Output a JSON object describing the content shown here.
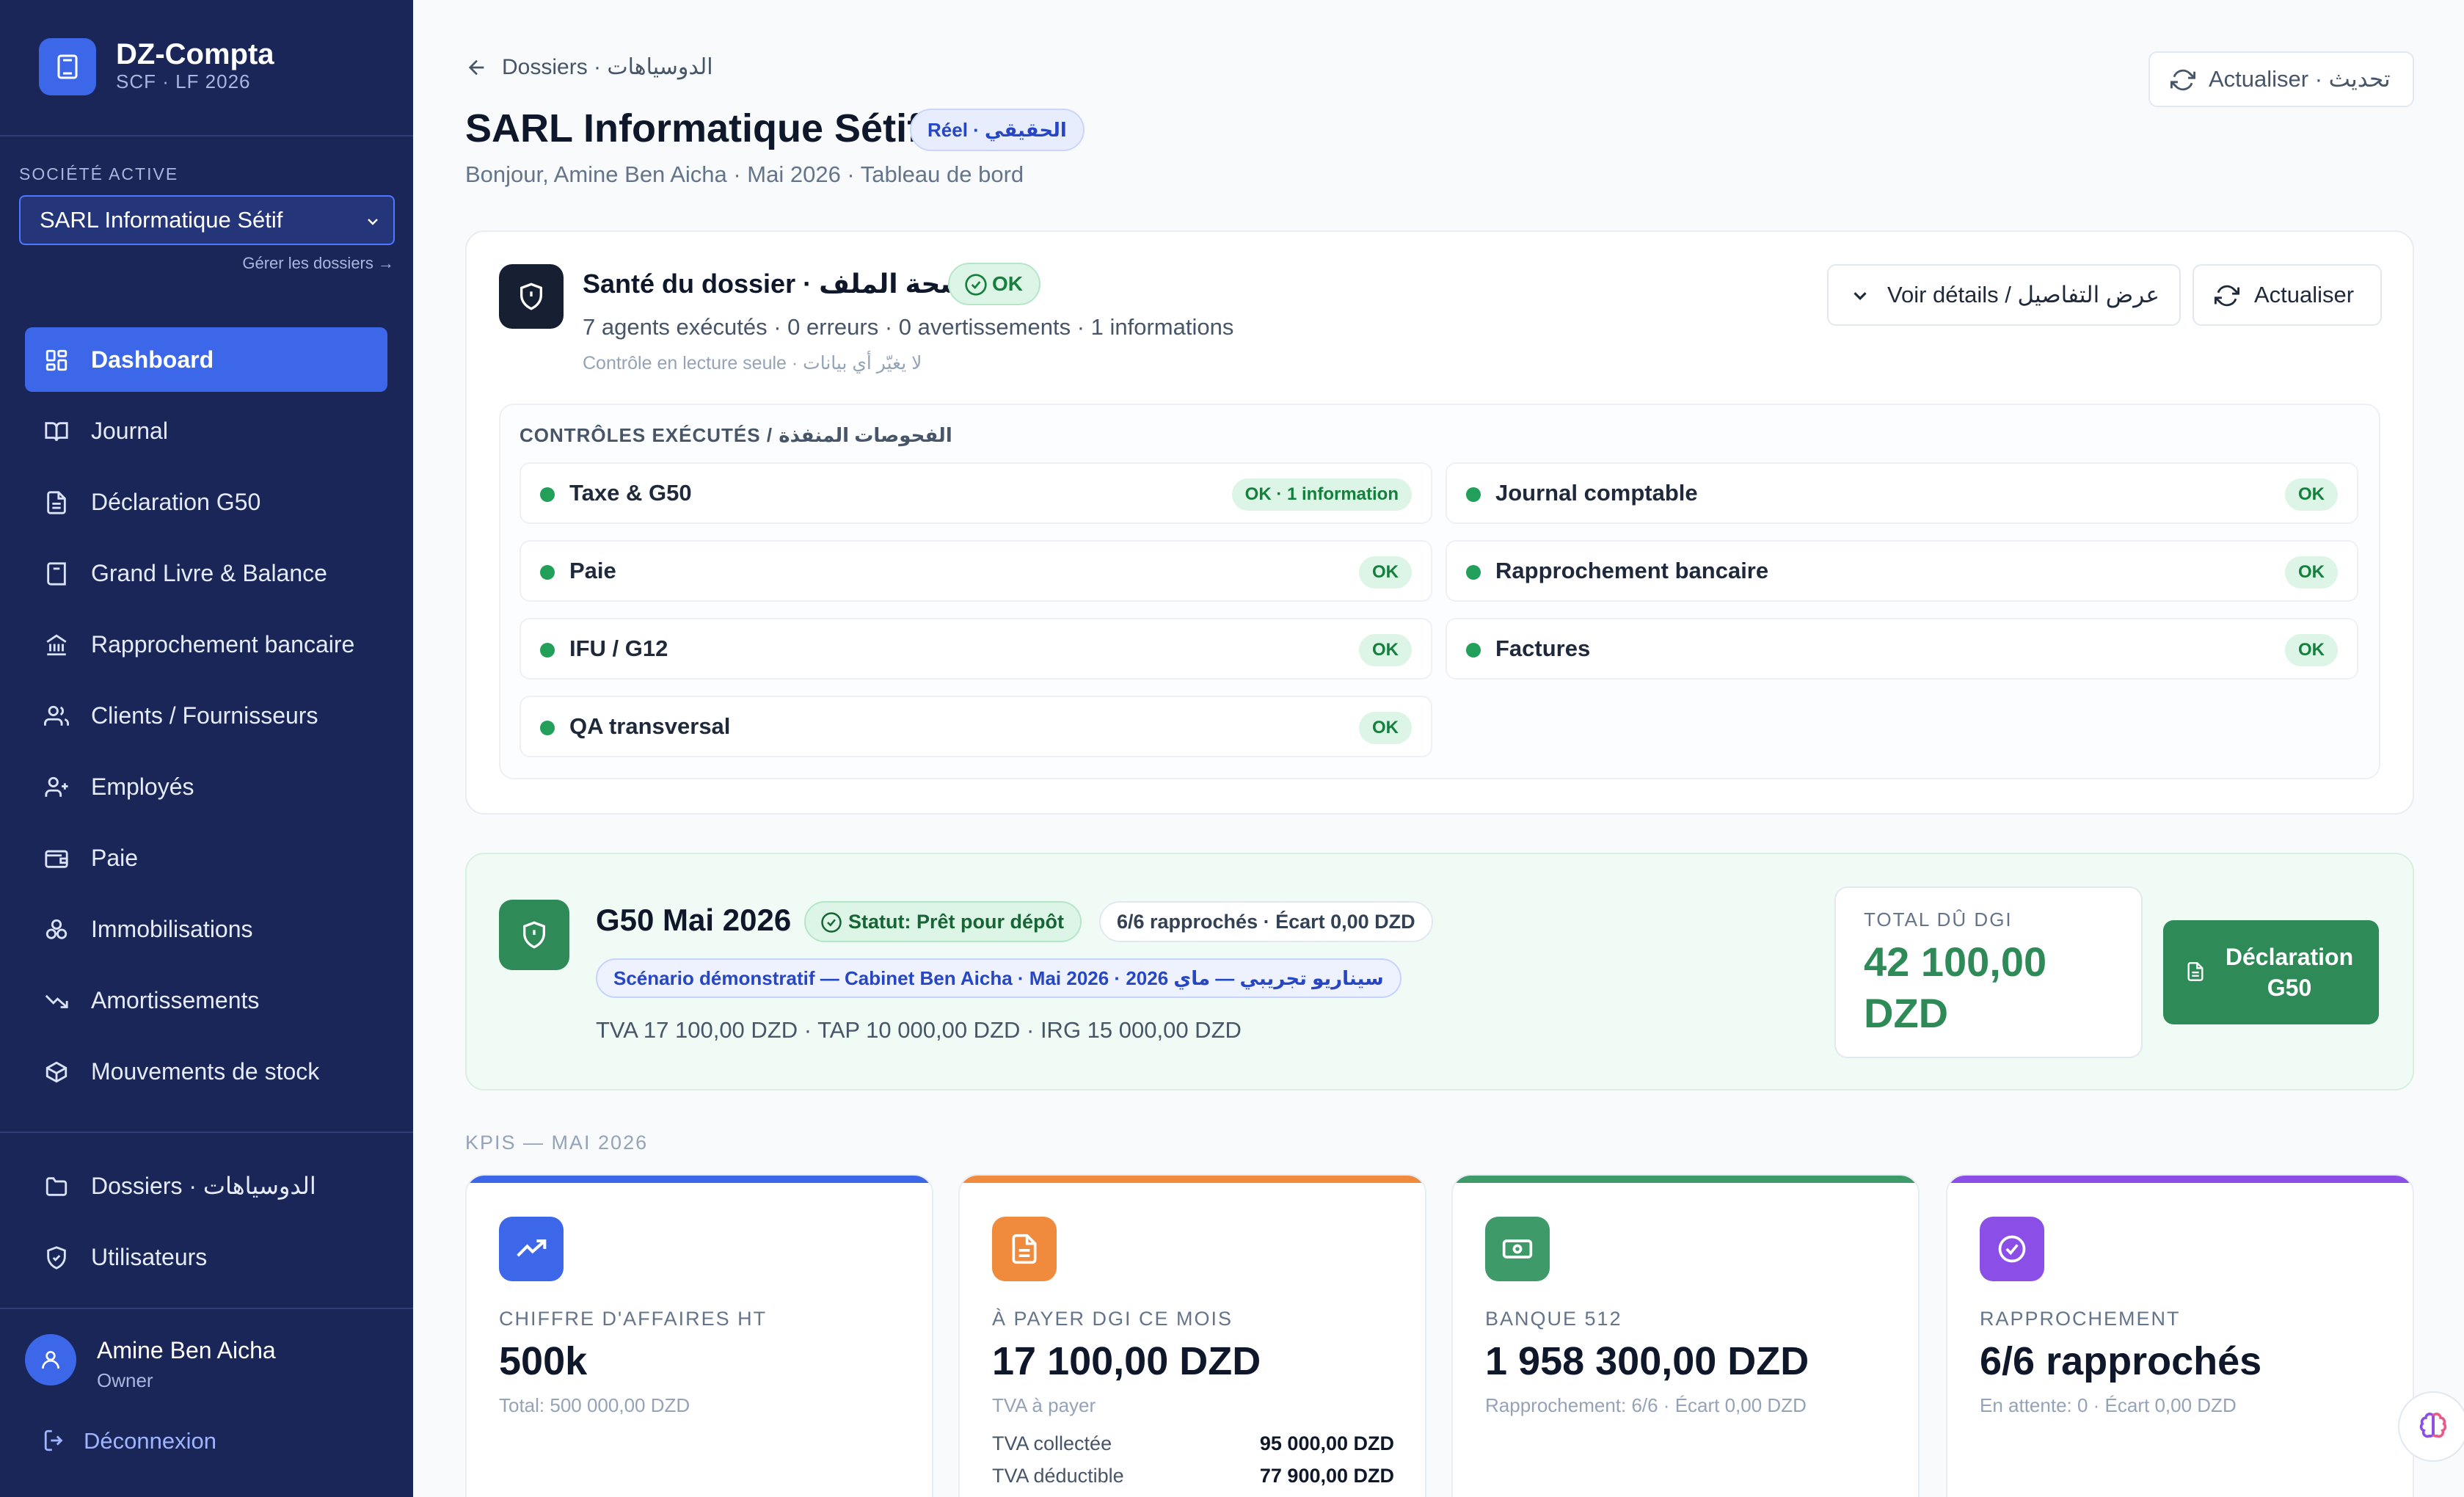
{
  "app": {
    "name": "DZ-Compta",
    "subtitle": "SCF · LF 2026"
  },
  "sidebar": {
    "company_label": "SOCIÉTÉ ACTIVE",
    "company_value": "SARL Informatique Sétif",
    "manage_link": "Gérer les dossiers →",
    "nav": [
      {
        "label": "Dashboard",
        "icon": "grid-icon",
        "active": true
      },
      {
        "label": "Journal",
        "icon": "book-open-icon"
      },
      {
        "label": "Déclaration G50",
        "icon": "document-icon"
      },
      {
        "label": "Grand Livre & Balance",
        "icon": "ledger-icon"
      },
      {
        "label": "Rapprochement bancaire",
        "icon": "bank-icon"
      },
      {
        "label": "Clients / Fournisseurs",
        "icon": "users-icon"
      },
      {
        "label": "Employés",
        "icon": "user-plus-icon"
      },
      {
        "label": "Paie",
        "icon": "wallet-icon"
      },
      {
        "label": "Immobilisations",
        "icon": "boxes-icon"
      },
      {
        "label": "Amortissements",
        "icon": "trending-down-icon"
      },
      {
        "label": "Mouvements de stock",
        "icon": "package-icon"
      }
    ],
    "bottom_nav": [
      {
        "label": "Dossiers · الدوسياهات",
        "icon": "folder-icon"
      },
      {
        "label": "Utilisateurs",
        "icon": "shield-icon"
      }
    ],
    "user": {
      "name": "Amine Ben Aicha",
      "role": "Owner"
    },
    "logout": "Déconnexion"
  },
  "header": {
    "back_label": "Dossiers · الدوسياهات",
    "refresh_label": "Actualiser · تحديث",
    "title": "SARL Informatique Sétif",
    "regime_badge": "Réel · الحقيقي",
    "subtitle": "Bonjour, Amine Ben Aicha · Mai 2026 · Tableau de bord"
  },
  "health": {
    "title": "Santé du dossier · صحة الملف",
    "status": "OK",
    "stats": "7 agents exécutés · 0 erreurs · 0 avertissements · 1 informations",
    "note": "Contrôle en lecture seule · لا يغيّر أي بيانات",
    "details_button": "Voir détails / عرض التفاصيل",
    "refresh_button": "Actualiser",
    "checks_label": "CONTRÔLES EXÉCUTÉS / الفحوصات المنفذة",
    "checks": [
      {
        "name": "Taxe & G50",
        "status": "OK · 1 information"
      },
      {
        "name": "Journal comptable",
        "status": "OK"
      },
      {
        "name": "Paie",
        "status": "OK"
      },
      {
        "name": "Rapprochement bancaire",
        "status": "OK"
      },
      {
        "name": "IFU / G12",
        "status": "OK"
      },
      {
        "name": "Factures",
        "status": "OK"
      },
      {
        "name": "QA transversal",
        "status": "OK"
      }
    ]
  },
  "g50": {
    "title": "G50 Mai 2026",
    "status": "Statut: Prêt pour dépôt",
    "rappro": "6/6 rapprochés · Écart 0,00 DZD",
    "scenario": "Scénario démonstratif — Cabinet Ben Aicha · Mai 2026 · سيناريو تجريبي — ماي 2026",
    "taxes": "TVA 17 100,00 DZD · TAP 10 000,00 DZD · IRG 15 000,00 DZD",
    "total_label": "TOTAL DÛ DGI",
    "total_value": "42 100,00 DZD",
    "button": "Déclaration G50"
  },
  "kpis": {
    "label": "KPIS — MAI 2026",
    "cards": [
      {
        "label": "CHIFFRE D'AFFAIRES HT",
        "value": "500k",
        "sub": "Total: 500 000,00 DZD",
        "color": "#3b67e8",
        "icon": "trending-up-icon"
      },
      {
        "label": "À PAYER DGI CE MOIS",
        "value": "17 100,00 DZD",
        "sub": "TVA à payer",
        "color": "#f08a3c",
        "icon": "document-icon",
        "rows": [
          {
            "k": "TVA collectée",
            "v": "95 000,00 DZD"
          },
          {
            "k": "TVA déductible",
            "v": "77 900,00 DZD"
          }
        ]
      },
      {
        "label": "BANQUE 512",
        "value": "1 958 300,00 DZD",
        "sub": "Rapprochement: 6/6 · Écart 0,00 DZD",
        "color": "#3f9a6a",
        "icon": "banknote-icon"
      },
      {
        "label": "RAPPROCHEMENT",
        "value": "6/6 rapprochés",
        "sub": "En attente: 0 · Écart 0,00 DZD",
        "color": "#8b4fe8",
        "icon": "check-circle-icon"
      }
    ]
  }
}
